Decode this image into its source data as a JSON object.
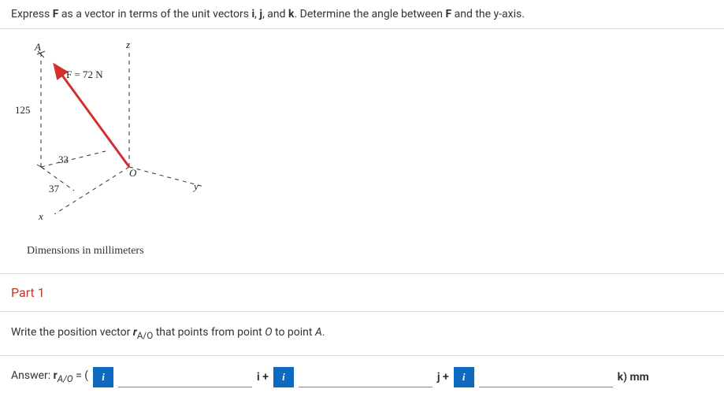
{
  "question": {
    "prefix": "Express ",
    "F": "F",
    "mid1": " as a vector in terms of the unit vectors ",
    "i": "i",
    "j": "j",
    "k": "k",
    "mid2": ", and ",
    "mid3": ". Determine the angle between ",
    "suffix": " and the y-axis.",
    "comma": ", "
  },
  "diagram": {
    "point_A": "A",
    "force_label": "F = 72 N",
    "dim_z": "125",
    "dim_x1": "33",
    "dim_x2": "37",
    "axis_x": "x",
    "axis_y": "y",
    "axis_z": "z",
    "origin": "O",
    "caption": "Dimensions in millimeters"
  },
  "part1": {
    "title": "Part 1",
    "prompt_prefix": "Write the position vector ",
    "r_label": "r",
    "r_sub": "A/O",
    "prompt_mid": " that points from point ",
    "O": "O",
    "prompt_mid2": " to point ",
    "A": "A",
    "prompt_suffix": "."
  },
  "answer": {
    "prefix": "Answer: ",
    "r_label": "r",
    "r_sub": "A/O",
    "equals": " = ( ",
    "info": "i",
    "i_plus": " i + ",
    "j_plus": " j + ",
    "k_unit": " k) mm"
  },
  "inputs": {
    "v1": "",
    "v2": "",
    "v3": ""
  }
}
